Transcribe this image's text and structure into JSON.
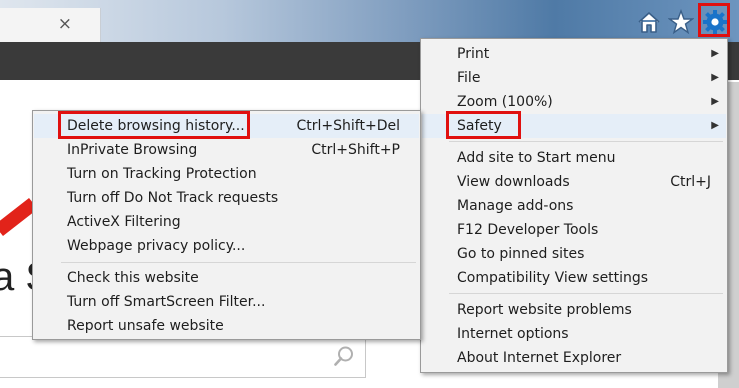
{
  "browser": {
    "tab_close_glyph": "×"
  },
  "toolbar_icons": [
    "home-icon",
    "star-icon",
    "gear-icon"
  ],
  "main_menu": {
    "items": [
      {
        "label": "Print",
        "shortcut": "",
        "submenu": true
      },
      {
        "label": "File",
        "shortcut": "",
        "submenu": true
      },
      {
        "label": "Zoom (100%)",
        "shortcut": "",
        "submenu": true
      },
      {
        "label": "Safety",
        "shortcut": "",
        "submenu": true
      },
      {
        "label": "Add site to Start menu",
        "shortcut": ""
      },
      {
        "label": "View downloads",
        "shortcut": "Ctrl+J"
      },
      {
        "label": "Manage add-ons",
        "shortcut": ""
      },
      {
        "label": "F12 Developer Tools",
        "shortcut": ""
      },
      {
        "label": "Go to pinned sites",
        "shortcut": ""
      },
      {
        "label": "Compatibility View settings",
        "shortcut": ""
      },
      {
        "label": "Report website problems",
        "shortcut": ""
      },
      {
        "label": "Internet options",
        "shortcut": ""
      },
      {
        "label": "About Internet Explorer",
        "shortcut": ""
      }
    ]
  },
  "safety_submenu": {
    "items": [
      {
        "label": "Delete browsing history...",
        "shortcut": "Ctrl+Shift+Del"
      },
      {
        "label": "InPrivate Browsing",
        "shortcut": "Ctrl+Shift+P"
      },
      {
        "label": "Turn on Tracking Protection",
        "shortcut": ""
      },
      {
        "label": "Turn off Do Not Track requests",
        "shortcut": ""
      },
      {
        "label": "ActiveX Filtering",
        "shortcut": ""
      },
      {
        "label": "Webpage privacy policy...",
        "shortcut": ""
      },
      {
        "label": "Check this website",
        "shortcut": ""
      },
      {
        "label": "Turn off SmartScreen Filter...",
        "shortcut": ""
      },
      {
        "label": "Report unsafe website",
        "shortcut": ""
      }
    ]
  },
  "page": {
    "big_letter": "a S"
  },
  "colors": {
    "highlight_box": "#e01010",
    "accent_blue": "#1a73c9",
    "menu_bg": "#f2f2f2"
  }
}
